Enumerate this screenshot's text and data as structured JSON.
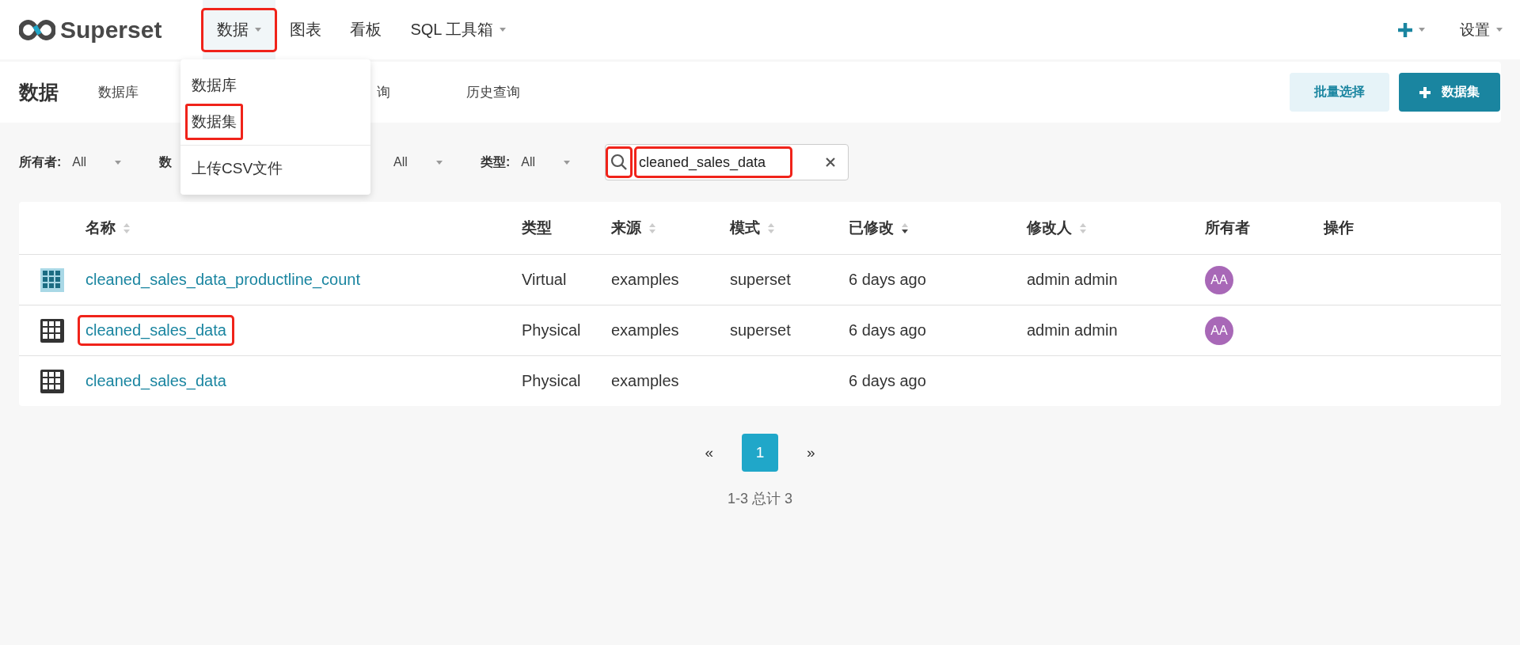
{
  "navbar": {
    "brand": "Superset",
    "items": [
      {
        "label": "数据",
        "selected": true,
        "dropdown": true,
        "highlighted": true
      },
      {
        "label": "图表",
        "selected": false,
        "dropdown": false,
        "highlighted": false
      },
      {
        "label": "看板",
        "selected": false,
        "dropdown": false,
        "highlighted": false
      },
      {
        "label": "SQL 工具箱",
        "selected": false,
        "dropdown": true,
        "highlighted": false
      }
    ],
    "right": [
      {
        "kind": "plus",
        "dropdown": true
      },
      {
        "kind": "text",
        "label": "设置",
        "dropdown": true
      }
    ]
  },
  "menu": {
    "items": [
      {
        "label": "数据库",
        "highlighted": false
      },
      {
        "label": "数据集",
        "highlighted": true
      },
      {
        "label": "上传CSV文件",
        "highlighted": false,
        "divider_before": true
      }
    ]
  },
  "subnav": {
    "title": "数据",
    "tabs": [
      {
        "label": "数据库"
      },
      {
        "label": "询"
      },
      {
        "label": "历史查询"
      }
    ],
    "buttons": [
      {
        "kind": "secondary",
        "label": "批量选择"
      },
      {
        "kind": "primary",
        "label": "数据集"
      }
    ]
  },
  "filters": [
    {
      "label": "所有者:",
      "value": "All"
    },
    {
      "label": "数",
      "value": "All"
    },
    {
      "label": "类型:",
      "value": "All"
    }
  ],
  "search": {
    "value": "cleaned_sales_data",
    "icon_highlighted": true,
    "value_highlighted": true
  },
  "table": {
    "columns": [
      {
        "label": "名称",
        "sortable": true,
        "sorted": false
      },
      {
        "label": "类型",
        "sortable": false
      },
      {
        "label": "来源",
        "sortable": true,
        "sorted": false
      },
      {
        "label": "模式",
        "sortable": true,
        "sorted": false
      },
      {
        "label": "已修改",
        "sortable": true,
        "sorted": true
      },
      {
        "label": "修改人",
        "sortable": true,
        "sorted": false
      },
      {
        "label": "所有者",
        "sortable": false
      },
      {
        "label": "操作",
        "sortable": false
      }
    ],
    "rows": [
      {
        "kind": "virtual",
        "name": "cleaned_sales_data_productline_count",
        "highlighted": false,
        "type": "Virtual",
        "source": "examples",
        "schema": "superset",
        "modified": "6 days ago",
        "modified_by": "admin admin",
        "owner": {
          "initials": "AA",
          "color": "#a868b7"
        }
      },
      {
        "kind": "physical",
        "name": "cleaned_sales_data",
        "highlighted": true,
        "type": "Physical",
        "source": "examples",
        "schema": "superset",
        "modified": "6 days ago",
        "modified_by": "admin admin",
        "owner": {
          "initials": "AA",
          "color": "#a868b7"
        }
      },
      {
        "kind": "physical",
        "name": "cleaned_sales_data",
        "highlighted": false,
        "type": "Physical",
        "source": "examples",
        "modified": "6 days ago"
      }
    ]
  },
  "pagination": {
    "prev": "«",
    "pages": [
      {
        "label": "1",
        "selected": true
      }
    ],
    "next": "»",
    "summary": "1-3 总计 3"
  }
}
